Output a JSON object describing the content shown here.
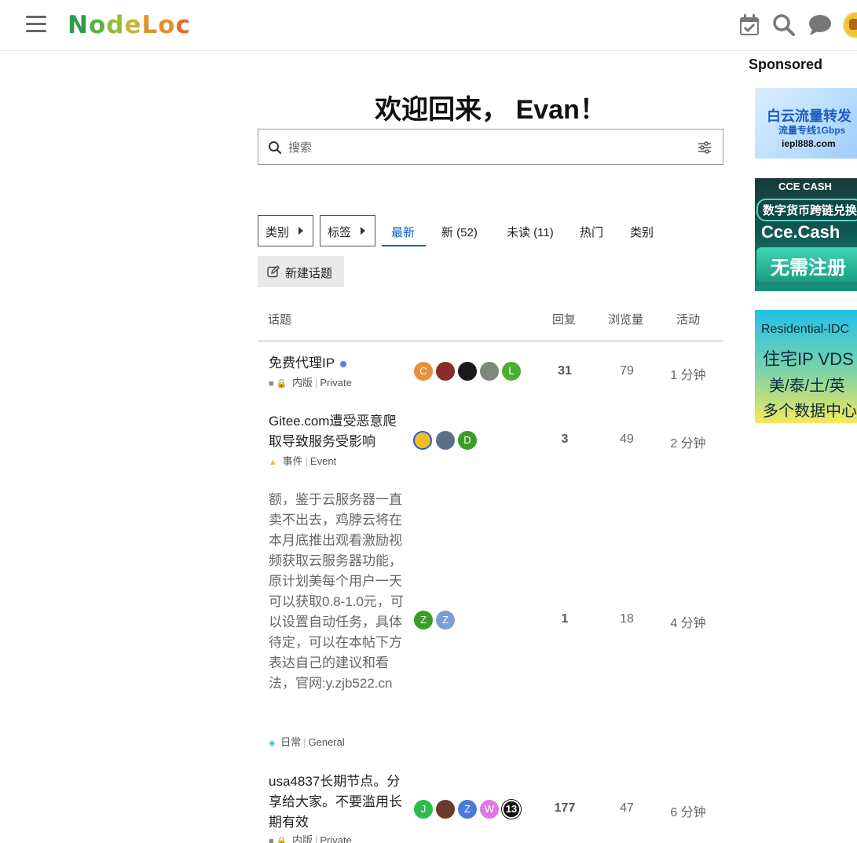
{
  "header": {
    "logo_text": "NodeLoc",
    "icons": [
      "menu-icon",
      "calendar-check-icon",
      "search-icon",
      "chat-bubble-icon",
      "user-avatar"
    ]
  },
  "sponsored": {
    "title": "Sponsored",
    "ads": [
      {
        "lines": [
          "白云流量转发",
          "流量专线1Gbps",
          "iepl888.com"
        ]
      },
      {
        "lines": [
          "CCE CASH",
          "数字货币跨链兑换",
          "Cce.Cash",
          "无需注册"
        ]
      },
      {
        "lines": [
          "Residential-IDC",
          "住宅IP VDS",
          "美/泰/土/英",
          "多个数据中心"
        ]
      }
    ]
  },
  "welcome": "欢迎回来， Evan！",
  "search": {
    "placeholder": "搜索"
  },
  "nav": {
    "categories_dropdown": "类别",
    "tags_dropdown": "标签",
    "tabs": [
      "最新",
      "新 (52)",
      "未读 (11)",
      "热门",
      "类别"
    ],
    "active_tab": "最新"
  },
  "new_topic_label": "新建话题",
  "table": {
    "headers": {
      "topic": "话题",
      "replies": "回复",
      "views": "浏览量",
      "activity": "活动"
    },
    "rows": [
      {
        "title": "免费代理IP",
        "unread_dot": true,
        "category": "内版",
        "category_en": "Private",
        "category_color": "#888888",
        "avatars": [
          {
            "letter": "C",
            "color": "#e8913a"
          },
          {
            "letter": "",
            "color": "#8b2a2a"
          },
          {
            "letter": "",
            "color": "#1a1a1a"
          },
          {
            "letter": "",
            "color": "#7a8a7a"
          },
          {
            "letter": "L",
            "color": "#4caf2f"
          }
        ],
        "replies": "31",
        "views": "79",
        "activity": "1 分钟"
      },
      {
        "title": "Gitee.com遭受恶意爬取导致服务受影响",
        "category": "事件",
        "category_en": "Event",
        "category_color": "#f0c020",
        "avatars": [
          {
            "letter": "",
            "color": "#2a5ad8"
          },
          {
            "letter": "",
            "color": "#5a6f8a"
          },
          {
            "letter": "D",
            "color": "#3a9e26"
          }
        ],
        "replies": "3",
        "views": "49",
        "activity": "2 分钟"
      },
      {
        "title": "额，鉴于云服务器一直卖不出去，鸡脖云将在本月底推出观看激励视频获取云服务器功能，原计划美每个用户一天可以获取0.8-1.0元，可以设置自动任务，具体待定，可以在本帖下方表达自己的建议和看法，官网:y.zjb522.cn",
        "category": "日常",
        "category_en": "General",
        "category_color": "#25b8c8",
        "avatars": [
          {
            "letter": "Z",
            "color": "#3a9e26"
          },
          {
            "letter": "Z",
            "color": "#7b9ed8"
          }
        ],
        "replies": "1",
        "views": "18",
        "activity": "4 分钟"
      },
      {
        "title": "usa4837长期节点。分享给大家。不要滥用长期有效",
        "category": "内版",
        "category_en": "Private",
        "category_color": "#888888",
        "avatars": [
          {
            "letter": "J",
            "color": "#2fba4f"
          },
          {
            "letter": "",
            "color": "#6a3a2a"
          },
          {
            "letter": "Z",
            "color": "#4a7ad8"
          },
          {
            "letter": "W",
            "color": "#e07ae0"
          },
          {
            "letter": "13",
            "color": "#111111"
          }
        ],
        "replies": "177",
        "views": "47",
        "activity": "6 分钟"
      }
    ]
  },
  "colors": {
    "accent": "#0a5bc8",
    "header_border": "#e9e9e9"
  }
}
